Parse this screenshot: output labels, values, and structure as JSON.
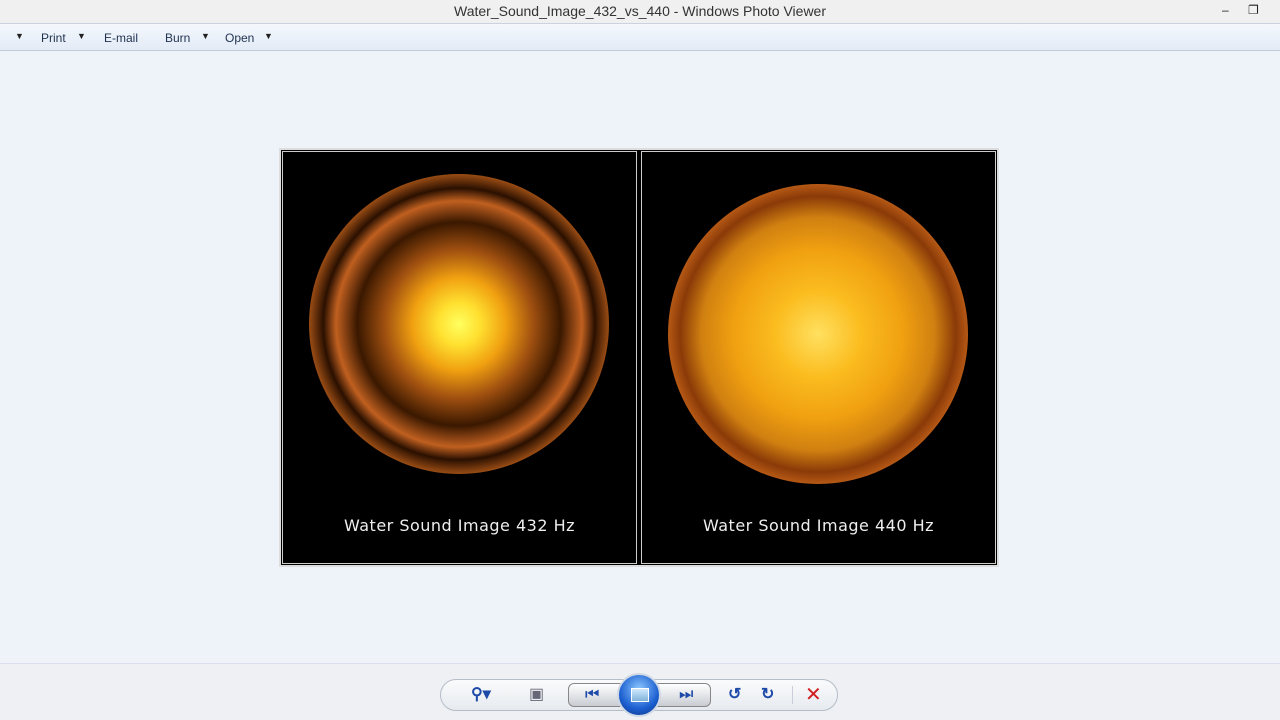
{
  "window": {
    "title": "Water_Sound_Image_432_vs_440 - Windows Photo Viewer"
  },
  "menu": {
    "items": [
      {
        "label": "Print"
      },
      {
        "label": "E-mail"
      },
      {
        "label": "Burn"
      },
      {
        "label": "Open"
      }
    ]
  },
  "image": {
    "left_caption": "Water Sound Image 432 Hz",
    "right_caption": "Water Sound Image 440 Hz"
  },
  "toolbar": {
    "icons": [
      "zoom-icon",
      "actual-size-icon",
      "previous-icon",
      "slideshow-icon",
      "next-icon",
      "rotate-ccw-icon",
      "rotate-cw-icon",
      "delete-icon"
    ]
  }
}
